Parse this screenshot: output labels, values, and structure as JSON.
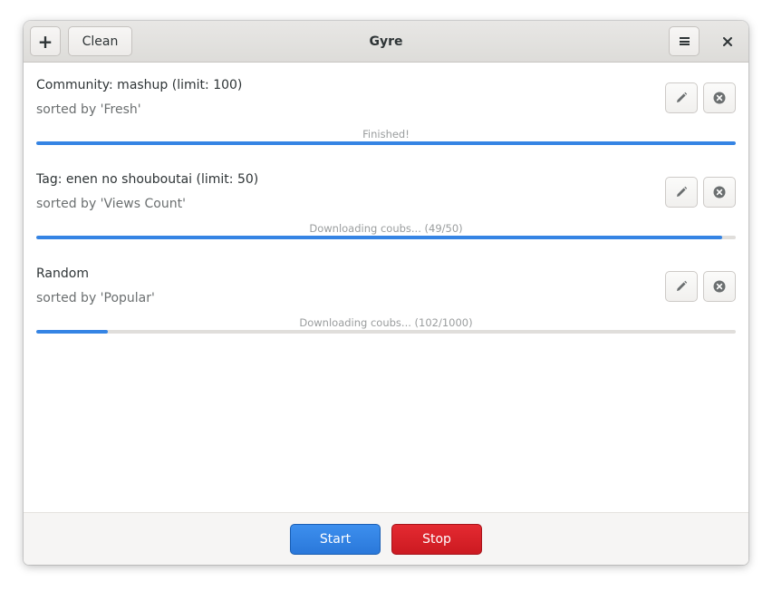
{
  "window": {
    "title": "Gyre"
  },
  "header": {
    "add_label": "+",
    "clean_label": "Clean",
    "menu_icon": "hamburger-menu-icon",
    "close_label": "✕"
  },
  "tasks": [
    {
      "title": "Community: mashup (limit: 100)",
      "sort": "sorted by 'Fresh'",
      "status": "Finished!",
      "progress": 1.0
    },
    {
      "title": "Tag: enen no shouboutai (limit: 50)",
      "sort": "sorted by 'Views Count'",
      "status": "Downloading coubs... (49/50)",
      "progress": 0.98
    },
    {
      "title": "Random",
      "sort": "sorted by 'Popular'",
      "status": "Downloading coubs... (102/1000)",
      "progress": 0.102
    }
  ],
  "actions": {
    "start_label": "Start",
    "stop_label": "Stop"
  },
  "colors": {
    "accent": "#3584e4",
    "start": "#3584e4",
    "stop": "#e01b24"
  }
}
